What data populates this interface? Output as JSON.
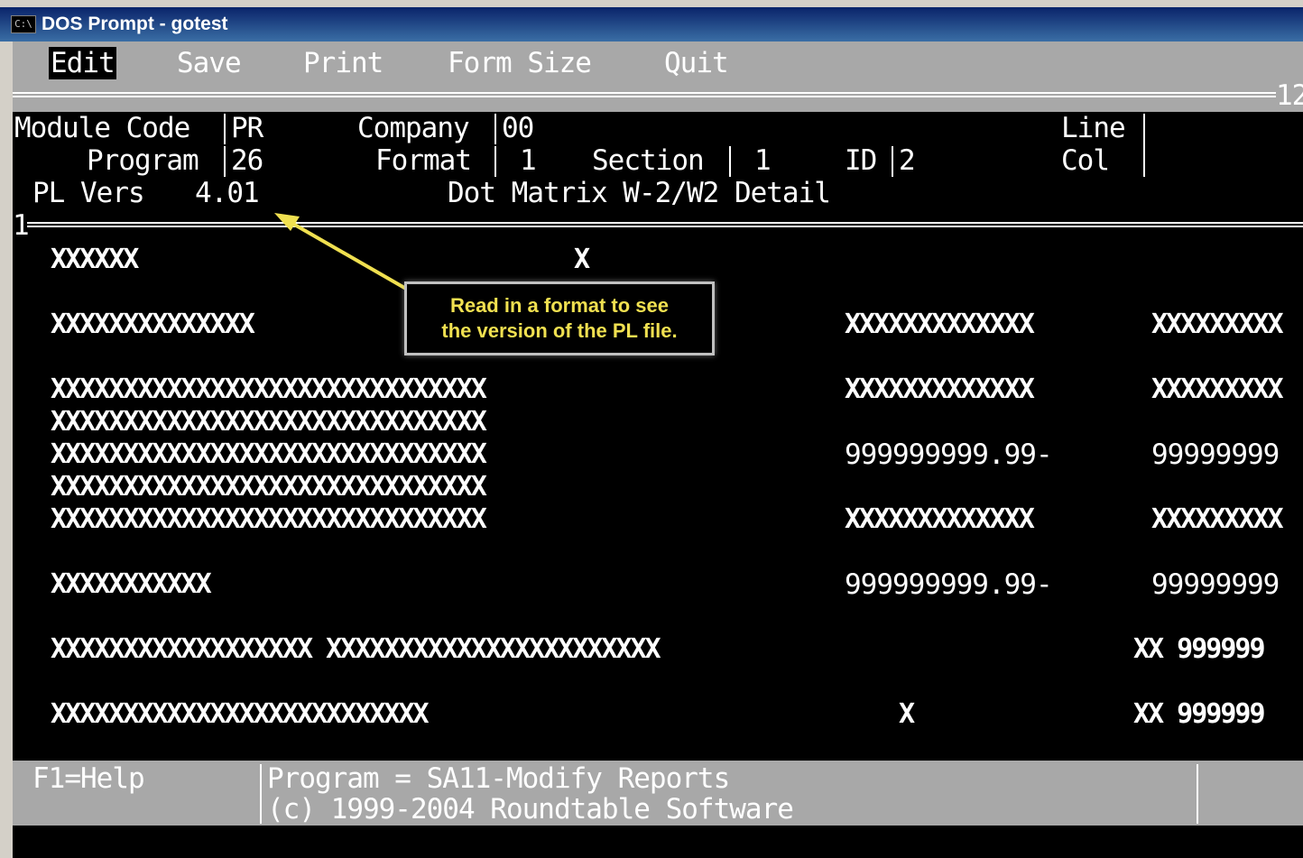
{
  "window": {
    "title": "DOS Prompt - gotest",
    "icon_text": "C:\\"
  },
  "menu": {
    "items": [
      "Edit",
      "Save",
      "Print",
      "Form Size",
      "Quit"
    ]
  },
  "ruler": {
    "top_number": "12",
    "left_number": "1"
  },
  "header": {
    "module_code_label": "Module Code",
    "module_code_value": "PR",
    "program_label": "Program",
    "program_value": "26",
    "pl_vers_label": "PL Vers",
    "pl_vers_value": "4.01",
    "company_label": "Company",
    "company_value": "00",
    "format_label": "Format",
    "format_value": "1",
    "section_label": "Section",
    "section_value": "1",
    "id_label": "ID",
    "id_value": "2",
    "line_label": "Line",
    "col_label": "Col",
    "description": "Dot Matrix W-2/W2 Detail"
  },
  "layout_rows": {
    "r1a": "XXXXXX",
    "r1b": "X",
    "r2a": "XXXXXXXXXXXXXX",
    "r2b": "XXXXXXXXXXXXX",
    "r2c": "XXXXXXXXX",
    "r3a": "XXXXXXXXXXXXXXXXXXXXXXXXXXXXXX",
    "r3b": "XXXXXXXXXXXXX",
    "r3c": "XXXXXXXXX",
    "r4a": "XXXXXXXXXXXXXXXXXXXXXXXXXXXXXX",
    "r5a": "XXXXXXXXXXXXXXXXXXXXXXXXXXXXXX",
    "r5b": "999999999.99-",
    "r5c": "99999999",
    "r6a": "XXXXXXXXXXXXXXXXXXXXXXXXXXXXXX",
    "r7a": "XXXXXXXXXXXXXXXXXXXXXXXXXXXXXX",
    "r7b": "XXXXXXXXXXXXX",
    "r7c": "XXXXXXXXX",
    "r8a": "XXXXXXXXXXX",
    "r8b": "999999999.99-",
    "r8c": "99999999",
    "r9a": "XXXXXXXXXXXXXXXXXX XXXXXXXXXXXXXXXXXXXXXXX",
    "r9c": "XX 999999",
    "r10a": "XXXXXXXXXXXXXXXXXXXXXXXXXX",
    "r10b": "X",
    "r10c": "XX 999999"
  },
  "tooltip": {
    "line1": "Read in a format to see",
    "line2": "the version of the PL file."
  },
  "status": {
    "help": "F1=Help",
    "program": "Program = SA11-Modify Reports",
    "copyright": "(c) 1999-2004 Roundtable Software"
  },
  "colors": {
    "console_bg": "#000000",
    "text": "#ffffff",
    "band": "#a8a8a8",
    "tooltip_text": "#f0e050",
    "arrow": "#f0e050"
  }
}
